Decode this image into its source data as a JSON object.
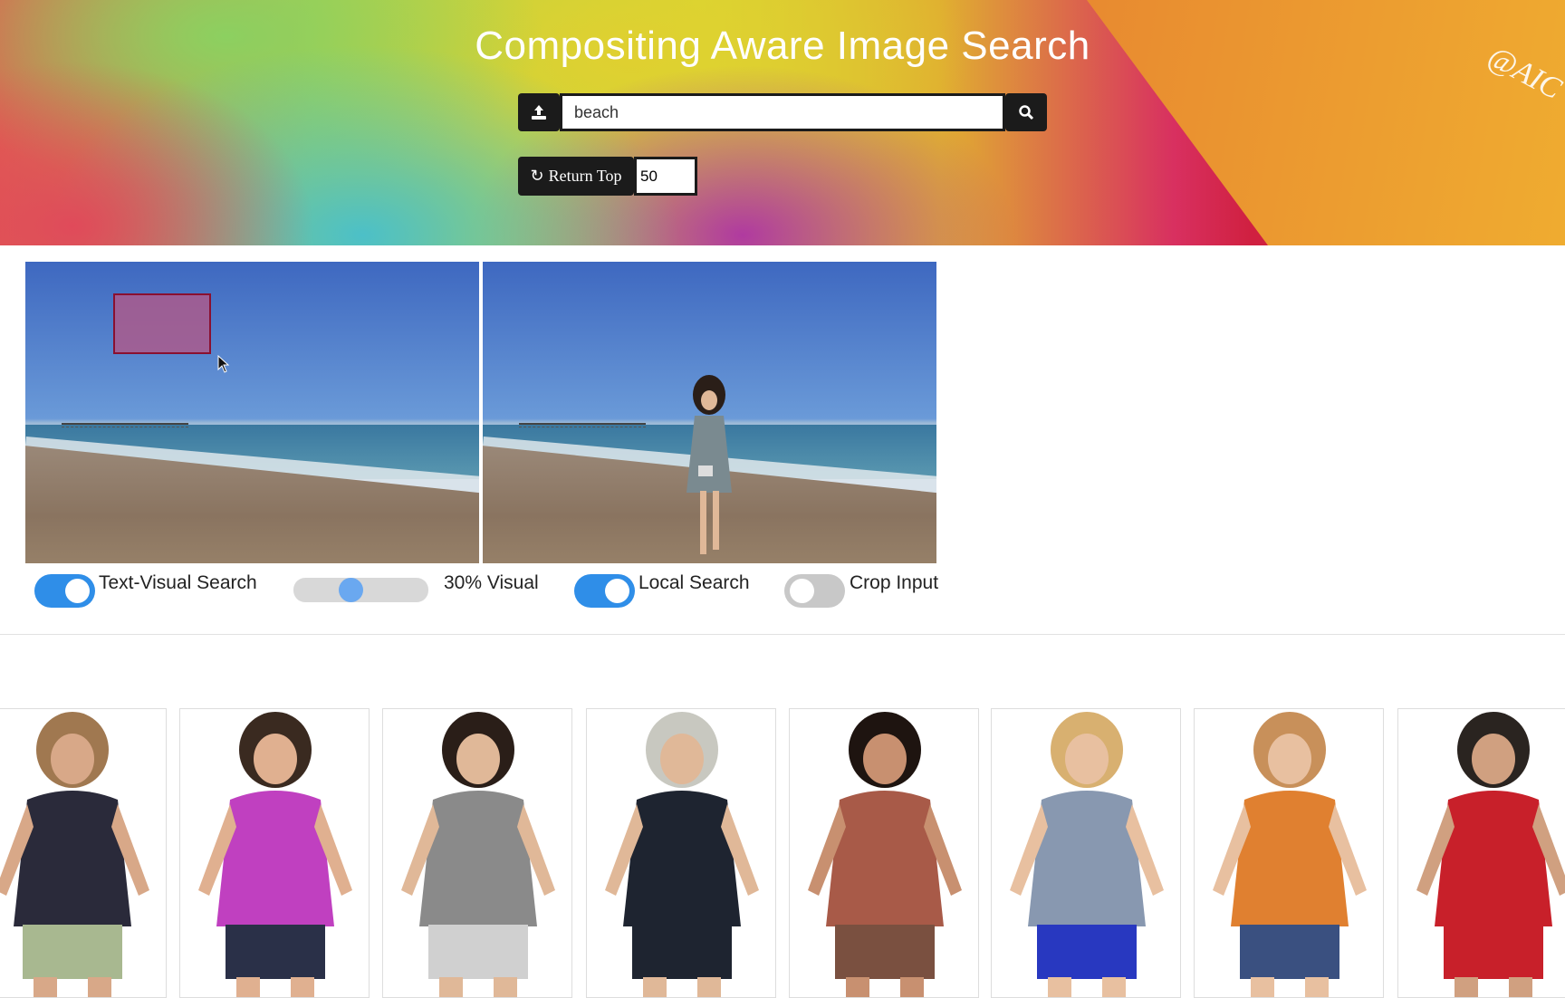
{
  "header": {
    "title": "Compositing Aware Image Search",
    "watermark": "@AICV"
  },
  "search": {
    "query": "beach",
    "upload_icon": "upload-icon",
    "search_icon": "search-icon"
  },
  "controls": {
    "return_top_label": "Return Top",
    "return_icon": "refresh-icon",
    "top_k": "50"
  },
  "options": {
    "text_visual": {
      "label": "Text-Visual Search",
      "enabled": true
    },
    "visual_weight": {
      "label": "30% Visual",
      "percent": 30
    },
    "local_search": {
      "label": "Local Search",
      "enabled": true
    },
    "crop_input": {
      "label": "Crop Input",
      "enabled": false
    }
  },
  "colors": {
    "accent": "#2f8ee8",
    "button": "#1b1b1b",
    "selection": "#aa5a8c"
  },
  "results": [
    {
      "shirt": "#2a2a3a",
      "skin": "#d8a888",
      "hair": "#a07850",
      "pants": "#a8b890"
    },
    {
      "shirt": "#c040c0",
      "skin": "#e0b090",
      "hair": "#3a2a20",
      "pants": "#2a3048"
    },
    {
      "shirt": "#8a8a8a",
      "skin": "#e0b898",
      "hair": "#2a1e18",
      "pants": "#d0d0d0"
    },
    {
      "shirt": "#1e2430",
      "skin": "#e0b898",
      "hair": "#c8c8c0",
      "pants": "#1e2430"
    },
    {
      "shirt": "#a85a48",
      "skin": "#c89070",
      "hair": "#1e1410",
      "pants": "#7a5040"
    },
    {
      "shirt": "#8898b0",
      "skin": "#e8c0a0",
      "hair": "#d8b070",
      "pants": "#2838c0"
    },
    {
      "shirt": "#e08030",
      "skin": "#e8c0a0",
      "hair": "#c8905a",
      "pants": "#3a5080"
    },
    {
      "shirt": "#c8202a",
      "skin": "#d0a080",
      "hair": "#2a2420",
      "pants": "#c8202a"
    }
  ]
}
